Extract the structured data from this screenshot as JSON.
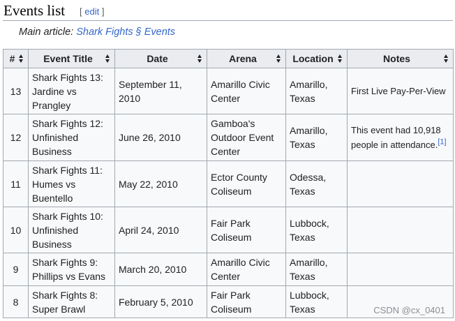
{
  "section": {
    "title": "Events list",
    "edit_open": "[ ",
    "edit_label": "edit",
    "edit_close": " ]"
  },
  "hatnote": {
    "prefix": "Main article: ",
    "link_text": "Shark Fights § Events"
  },
  "table": {
    "headers": [
      "#",
      "Event Title",
      "Date",
      "Arena",
      "Location",
      "Notes"
    ],
    "rows": [
      {
        "number": "13",
        "title": "Shark Fights 13: Jardine vs Prangley",
        "date": "September 11, 2010",
        "arena": "Amarillo Civic Center",
        "arena_is_link": true,
        "location": "Amarillo, Texas",
        "notes": "First Live Pay-Per-View",
        "ref": ""
      },
      {
        "number": "12",
        "title": "Shark Fights 12: Unfinished Business",
        "date": "June 26, 2010",
        "arena": "Gamboa's Outdoor Event Center",
        "arena_is_link": false,
        "location": "Amarillo, Texas",
        "notes": "This event had 10,918 people in attendance.",
        "ref": "[1]"
      },
      {
        "number": "11",
        "title": "Shark Fights 11: Humes vs Buentello",
        "date": "May 22, 2010",
        "arena": "Ector County Coliseum",
        "arena_is_link": true,
        "location": "Odessa, Texas",
        "notes": "",
        "ref": ""
      },
      {
        "number": "10",
        "title": "Shark Fights 10: Unfinished Business",
        "date": "April 24, 2010",
        "arena": "Fair Park Coliseum",
        "arena_is_link": true,
        "location": "Lubbock, Texas",
        "notes": "",
        "ref": ""
      },
      {
        "number": "9",
        "title": "Shark Fights 9: Phillips vs Evans",
        "date": "March 20, 2010",
        "arena": "Amarillo Civic Center",
        "arena_is_link": true,
        "location": "Amarillo, Texas",
        "notes": "",
        "ref": ""
      },
      {
        "number": "8",
        "title": "Shark Fights 8: Super Brawl",
        "date": "February 5, 2010",
        "arena": "Fair Park Coliseum",
        "arena_is_link": false,
        "location": "Lubbock, Texas",
        "notes": "",
        "ref": ""
      }
    ]
  },
  "watermark": "CSDN @cx_0401",
  "colors": {
    "link": "#3366cc",
    "header_bg": "#eaecf0",
    "cell_bg": "#f8f9fa",
    "border": "#a2a9b1"
  },
  "icons": {
    "sort": "sort-arrows-icon"
  }
}
